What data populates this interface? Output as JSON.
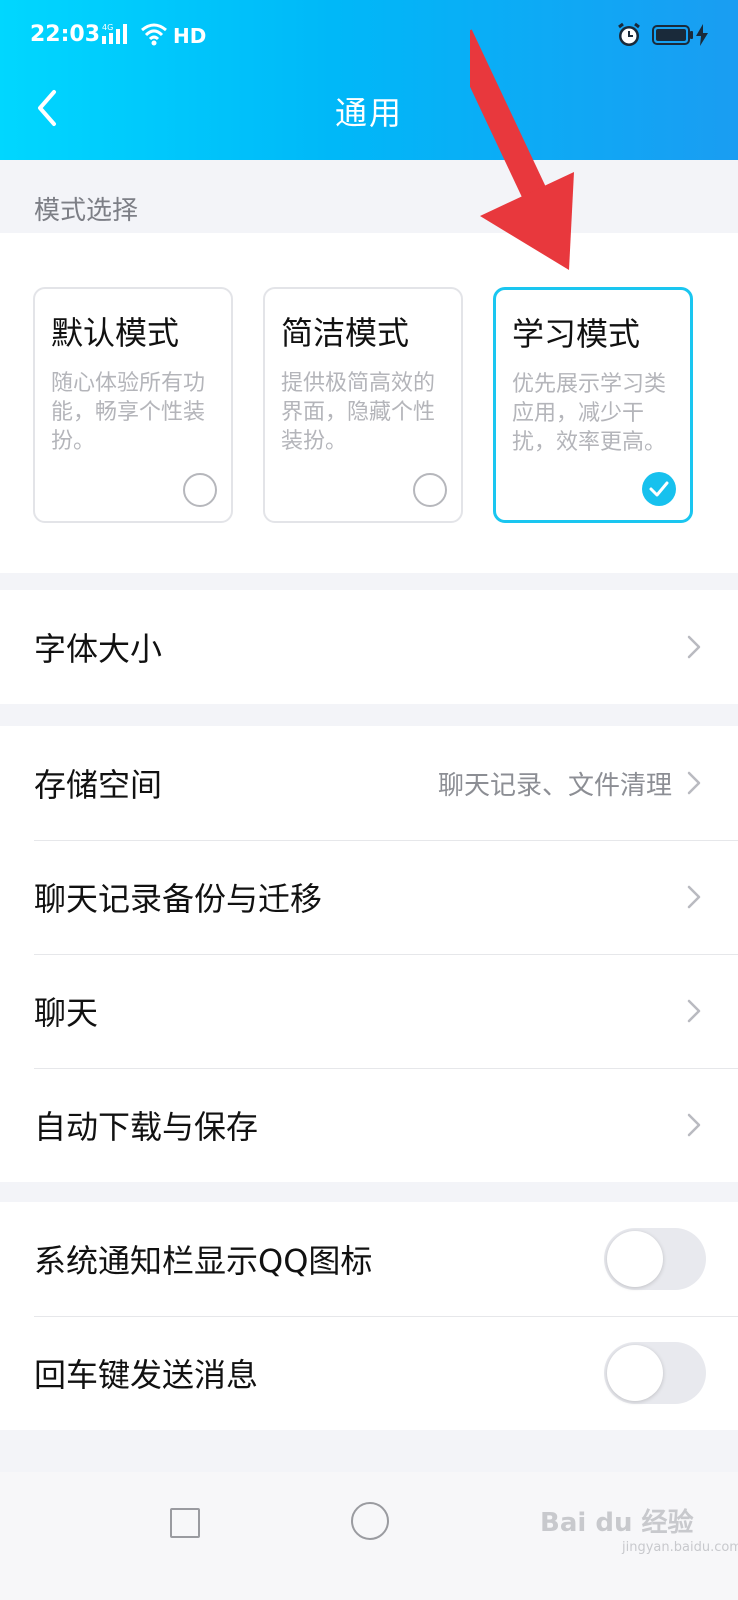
{
  "status_bar": {
    "time": "22:03",
    "network": "4G",
    "hd": "HD"
  },
  "nav": {
    "title": "通用"
  },
  "mode_section": {
    "label": "模式选择",
    "cards": [
      {
        "title": "默认模式",
        "desc": "随心体验所有功能，畅享个性装扮。",
        "selected": false
      },
      {
        "title": "简洁模式",
        "desc": "提供极简高效的界面，隐藏个性装扮。",
        "selected": false
      },
      {
        "title": "学习模式",
        "desc": "优先展示学习类应用，减少干扰，效率更高。",
        "selected": true
      }
    ]
  },
  "group1": [
    {
      "label": "字体大小"
    }
  ],
  "group2": [
    {
      "label": "存储空间",
      "value": "聊天记录、文件清理"
    },
    {
      "label": "聊天记录备份与迁移"
    },
    {
      "label": "聊天"
    },
    {
      "label": "自动下载与保存"
    }
  ],
  "group3": [
    {
      "label": "系统通知栏显示QQ图标",
      "toggle_on": false
    },
    {
      "label": "回车键发送消息",
      "toggle_on": false
    }
  ],
  "watermark": {
    "text": "Bai du 经验",
    "sub": "jingyan.baidu.com"
  },
  "colors": {
    "header_start": "#00d7ff",
    "header_end": "#1a9df2",
    "accent": "#17c1ee",
    "annotation": "#e8383d"
  },
  "icons": {
    "back": "chevron-left-icon",
    "row_arrow": "chevron-right-icon",
    "selected": "checkmark-icon",
    "annotation": "red-arrow-icon"
  }
}
